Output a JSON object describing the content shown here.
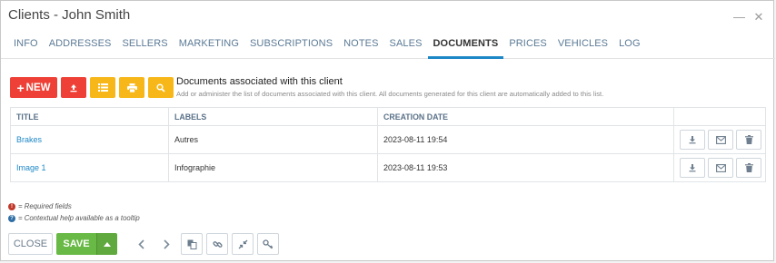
{
  "window": {
    "title": "Clients - John Smith",
    "minimize_glyph": "—",
    "close_glyph": "✕"
  },
  "tabs": [
    {
      "label": "INFO"
    },
    {
      "label": "ADDRESSES"
    },
    {
      "label": "SELLERS"
    },
    {
      "label": "MARKETING"
    },
    {
      "label": "SUBSCRIPTIONS"
    },
    {
      "label": "NOTES"
    },
    {
      "label": "SALES"
    },
    {
      "label": "DOCUMENTS",
      "active": true
    },
    {
      "label": "PRICES"
    },
    {
      "label": "VEHICLES"
    },
    {
      "label": "LOG"
    }
  ],
  "toolbar": {
    "new_label": "NEW",
    "icons": [
      "plus-icon",
      "upload-icon",
      "list-icon",
      "print-icon",
      "search-icon"
    ]
  },
  "documents_header": {
    "title": "Documents associated with this client",
    "subtitle": "Add or administer the list of documents associated with this client. All documents generated for this client are automatically added to this list."
  },
  "table": {
    "columns": [
      "TITLE",
      "LABELS",
      "CREATION DATE",
      ""
    ],
    "rows": [
      {
        "title": "Brakes",
        "labels": "Autres",
        "date": "2023-08-11 19:54"
      },
      {
        "title": "Image 1",
        "labels": "Infographie",
        "date": "2023-08-11 19:53"
      }
    ],
    "row_actions": [
      "download-icon",
      "email-icon",
      "trash-icon"
    ]
  },
  "legend": {
    "required": "= Required fields",
    "help": "= Contextual help available as a tooltip"
  },
  "footer": {
    "close_label": "CLOSE",
    "save_label": "SAVE"
  },
  "colors": {
    "accent": "#1e88c7",
    "new_button": "#ee4036",
    "action_yellow": "#f7b718",
    "save_green": "#69b946"
  }
}
